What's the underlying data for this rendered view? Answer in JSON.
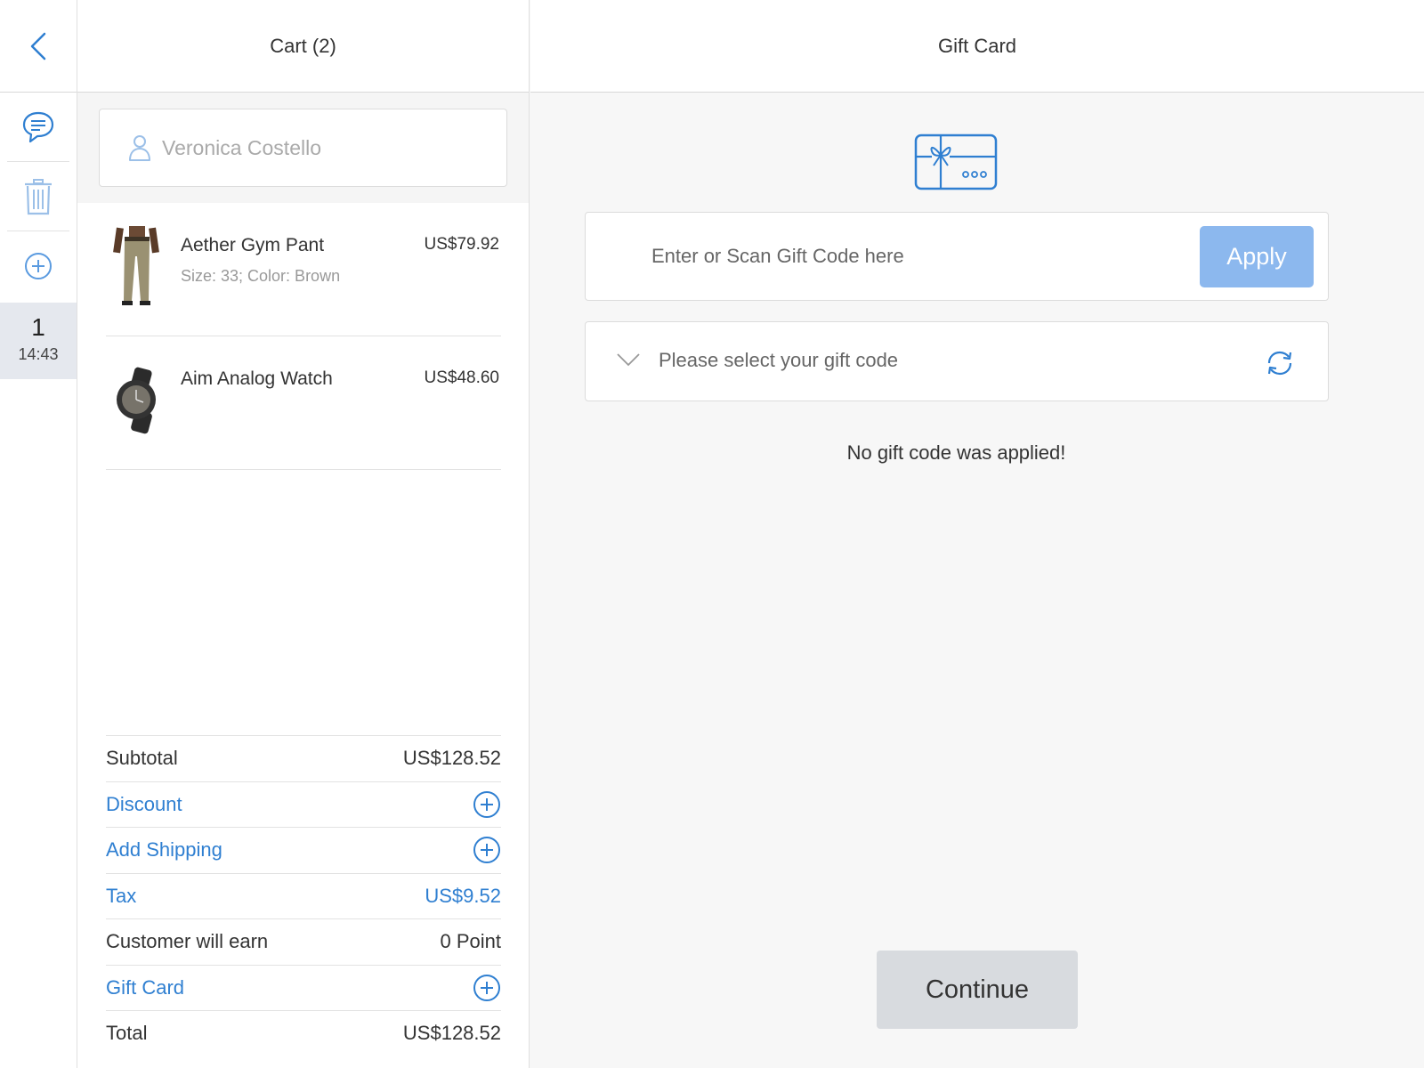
{
  "rail": {
    "order_number": "1",
    "order_time": "14:43"
  },
  "cart": {
    "title": "Cart (2)",
    "customer_name": "Veronica Costello",
    "items": [
      {
        "name": "Aether Gym Pant",
        "options": "Size: 33; Color: Brown",
        "price": "US$79.92"
      },
      {
        "name": "Aim Analog Watch",
        "options": "",
        "price": "US$48.60"
      }
    ],
    "totals": {
      "subtotal_label": "Subtotal",
      "subtotal_value": "US$128.52",
      "discount_label": "Discount",
      "shipping_label": "Add Shipping",
      "tax_label": "Tax",
      "tax_value": "US$9.52",
      "earn_label": "Customer will earn",
      "earn_value": "0 Point",
      "giftcard_label": "Gift Card",
      "total_label": "Total",
      "total_value": "US$128.52"
    }
  },
  "panel": {
    "title": "Gift Card",
    "code_placeholder": "Enter or Scan Gift Code here",
    "apply_label": "Apply",
    "select_placeholder": "Please select your gift code",
    "no_code_message": "No gift code was applied!",
    "continue_label": "Continue"
  },
  "colors": {
    "accent": "#2f7fd1",
    "apply_button": "#8cb8ee",
    "continue_button": "#d8dbdf",
    "selected_order_bg": "#e5e8ee"
  },
  "icons": {
    "back": "chevron-left-icon",
    "comment": "chat-bubble-icon",
    "delete": "trash-icon",
    "add": "plus-circle-icon",
    "customer": "user-icon",
    "gift": "gift-card-icon",
    "dropdown": "chevron-down-icon",
    "refresh": "sync-icon"
  }
}
